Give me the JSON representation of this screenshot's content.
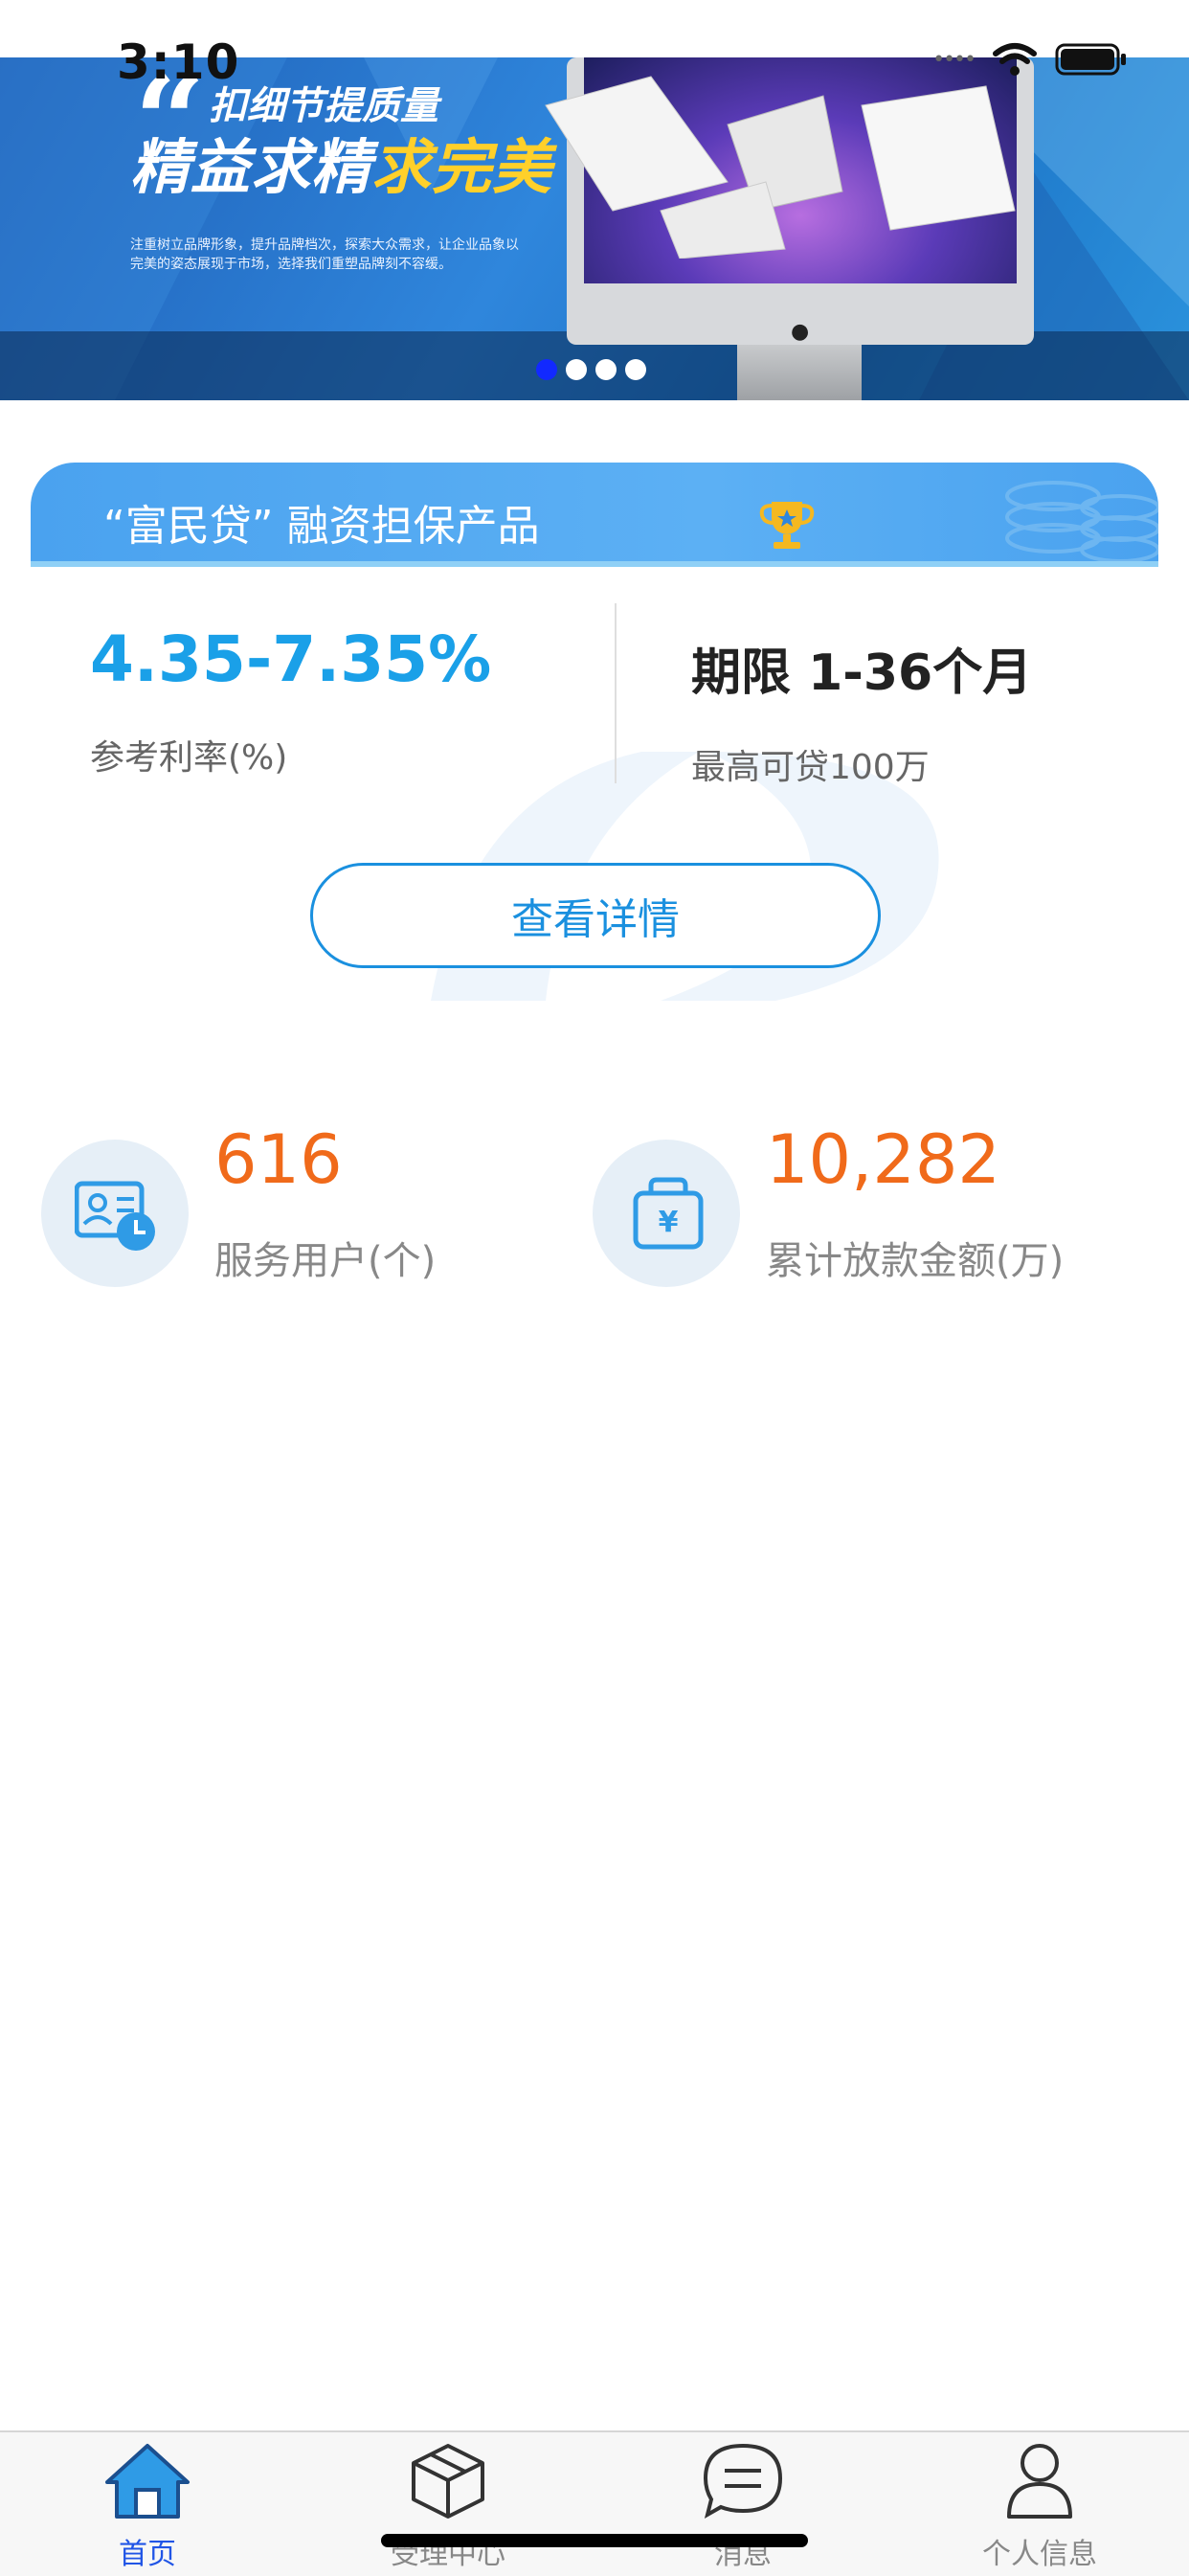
{
  "status_bar": {
    "time": "3:10"
  },
  "banner": {
    "quote_mark": "“",
    "headline_1": "扣细节提质量",
    "headline_2_main": "精益求精",
    "headline_2_accent": "求完美",
    "small_text": "注重树立品牌形象，提升品牌档次，探索大众需求，让企业品象以完美的姿态展现于市场，选择我们重塑品牌刻不容缓。",
    "dots_total": 4,
    "active_dot": 0
  },
  "product": {
    "title": "“富民贷” 融资担保产品",
    "rate_value": "4.35-7.35%",
    "rate_label": "参考利率(%)",
    "term": "期限 1-36个月",
    "max_loan": "最高可贷100万",
    "detail_button": "查看详情"
  },
  "stats": [
    {
      "value": "616",
      "label": "服务用户(个)",
      "icon": "user-card-clock-icon"
    },
    {
      "value": "10,282",
      "label": "累计放款金额(万)",
      "icon": "yuan-wallet-icon"
    }
  ],
  "tabbar": {
    "items": [
      {
        "label": "首页",
        "icon": "home-icon",
        "active": true
      },
      {
        "label": "受理中心",
        "icon": "box-icon",
        "active": false
      },
      {
        "label": "消息",
        "icon": "message-icon",
        "active": false
      },
      {
        "label": "个人信息",
        "icon": "person-icon",
        "active": false
      }
    ]
  },
  "colors": {
    "accent_blue": "#1aa0e8",
    "card_header": "#4aa2ef",
    "stat_orange": "#f06a1a",
    "tab_active": "#2155e6"
  }
}
